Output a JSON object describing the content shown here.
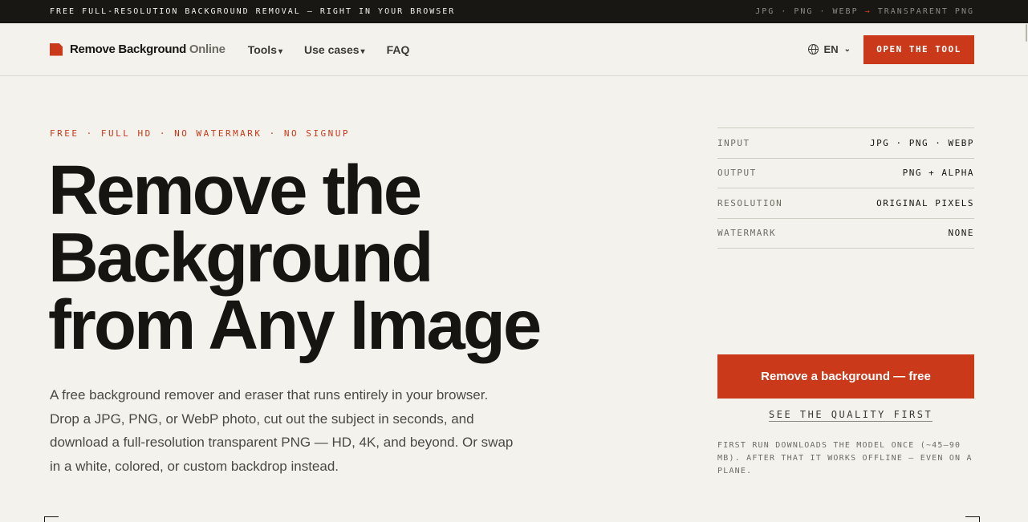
{
  "topbar": {
    "left_text": "FREE FULL-RESOLUTION BACKGROUND REMOVAL — RIGHT IN YOUR BROWSER",
    "right_formats": "JPG · PNG · WEBP",
    "right_arrow": "→",
    "right_result": "TRANSPARENT PNG"
  },
  "header": {
    "logo_main": "Remove Background",
    "logo_sub": "Online",
    "nav": {
      "tools": "Tools",
      "use_cases": "Use cases",
      "faq": "FAQ",
      "caret": "▾"
    },
    "lang": "EN",
    "lang_chevron": "⌄",
    "open_tool": "OPEN THE TOOL",
    "icons": {
      "logo": "logo-mark-icon",
      "lang": "globe-icon"
    }
  },
  "hero": {
    "eyebrow": "FREE · FULL HD · NO WATERMARK · NO SIGNUP",
    "headline_line1": "Remove the",
    "headline_line2": "Background",
    "headline_line3": "from Any Image",
    "lede": "A free background remover and eraser that runs entirely in your browser. Drop a JPG, PNG, or WebP photo, cut out the subject in seconds, and download a full-resolution transparent PNG — HD, 4K, and beyond. Or swap in a white, colored, or custom backdrop instead."
  },
  "specs": [
    {
      "key": "INPUT",
      "value": "JPG · PNG · WEBP"
    },
    {
      "key": "OUTPUT",
      "value": "PNG + ALPHA"
    },
    {
      "key": "RESOLUTION",
      "value": "ORIGINAL PIXELS"
    },
    {
      "key": "WATERMARK",
      "value": "NONE"
    }
  ],
  "cta": {
    "primary": "Remove a background — free",
    "secondary": "SEE THE QUALITY FIRST",
    "footnote": "FIRST RUN DOWNLOADS THE MODEL ONCE (~45–90 MB). AFTER THAT IT WORKS OFFLINE — EVEN ON A PLANE."
  },
  "colors": {
    "accent": "#c9391a",
    "ink": "#161511",
    "paper": "#f4f2ec",
    "topbar_bg": "#181713"
  }
}
